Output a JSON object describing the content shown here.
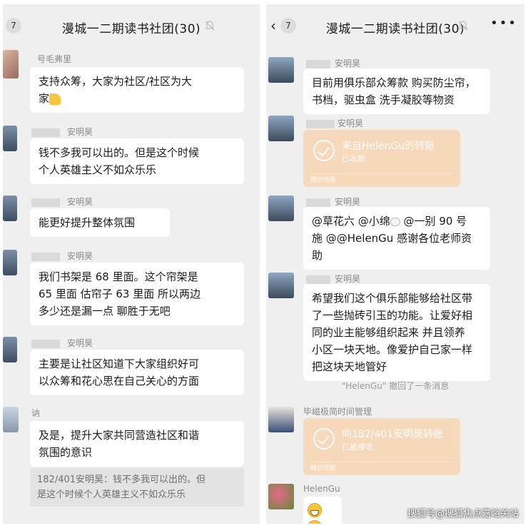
{
  "left": {
    "unread": "7",
    "title": "漫城一二期读书社团(30)",
    "messages": [
      {
        "name": "号毛弗里",
        "text1": "支持众筹，大家为社区/社区为大",
        "text2": "家"
      },
      {
        "name": "安明昊",
        "text1": "钱不多我可以出的。但是这个时候",
        "text2": "个人英雄主义不如众乐乐"
      },
      {
        "name": "安明昊",
        "text1": "能更好提升整体氛围"
      },
      {
        "name": "安明昊",
        "text1": "我们书架是 68 里面。这个帘架是",
        "text2": "65 里面 估帘子 63 里面 所以两边",
        "text3": "多少还是漏一点 聊胜于无吧"
      },
      {
        "name": "安明昊",
        "text1": "主要是让社区知道下大家组织好可",
        "text2": "以众筹和花心思在自己关心的方面"
      },
      {
        "name": "讷",
        "text1": "及是，提升大家共同营造社区和谐",
        "text2": "氛围的意识"
      }
    ],
    "quote": {
      "line1": "182/401安明昊：钱不多我可以出的。但",
      "line2": "是这个时候个人英雄主义不如众乐乐"
    }
  },
  "right": {
    "unread": "7",
    "title": "漫城一二期读书社团(30)",
    "more": "•••",
    "messages": [
      {
        "name": "安明昊",
        "text1": "目前用俱乐部众筹款 购买防尘帘，",
        "text2": "书档，驱虫盒 洗手凝胶等物资"
      },
      {
        "name": "安明昊",
        "transfer_title": "来自HelenGu的转账",
        "transfer_status": "已收款",
        "transfer_footer": "微信转账"
      },
      {
        "name": "安明昊",
        "text1a": "@草花六 @小绵",
        "text1b": " @一别 90 号",
        "text2": "施 @@HelenGu 感谢各位老师资",
        "text3": "助"
      },
      {
        "name": "安明昊",
        "text1": "希望我们这个俱乐部能够给社区带",
        "text2": "了一些抛砖引玉的功能。让爱好相",
        "text3": "同的业主能够组织起来 并且领养",
        "text4": "小区一块天地。像爱护自己家一样",
        "text5": "把这块天地管好"
      },
      {
        "name": "毕嵫极简时间管理",
        "transfer_title": "向182/401安明昊转账",
        "transfer_status": "已被接收",
        "transfer_footer": "微信转账"
      },
      {
        "name": "HelenGu"
      }
    ],
    "recall": "\"HelenGu\" 撤回了一条消息"
  },
  "watermark": "搜狐号@搜狐焦点嘉峪关站"
}
